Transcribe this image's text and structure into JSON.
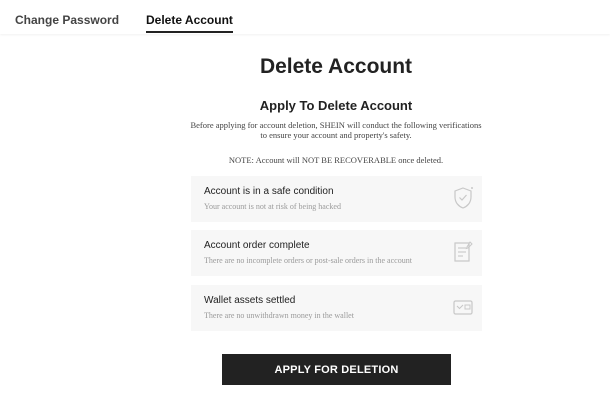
{
  "tabs": {
    "change_password": "Change Password",
    "delete_account": "Delete Account",
    "active": "delete_account"
  },
  "page": {
    "title": "Delete Account",
    "subtitle": "Apply To Delete Account",
    "description_line1": "Before applying for account deletion, SHEIN will conduct the following verifications",
    "description_line2": "to ensure your account and property's safety.",
    "note": "NOTE: Account will NOT BE RECOVERABLE once deleted."
  },
  "checks": [
    {
      "title": "Account is in a safe condition",
      "description": "Your account is not at risk of being hacked",
      "icon": "shield-check-icon"
    },
    {
      "title": "Account order complete",
      "description": "There are no incomplete orders or post-sale orders in the account",
      "icon": "order-document-icon"
    },
    {
      "title": "Wallet assets settled",
      "description": "There are no unwithdrawn money in the wallet",
      "icon": "wallet-icon"
    }
  ],
  "actions": {
    "apply_label": "APPLY FOR DELETION"
  },
  "colors": {
    "primary": "#222222",
    "card_background": "#f7f7f7",
    "muted_text": "#9a9a9a",
    "icon_stroke": "#c8c8c8"
  }
}
